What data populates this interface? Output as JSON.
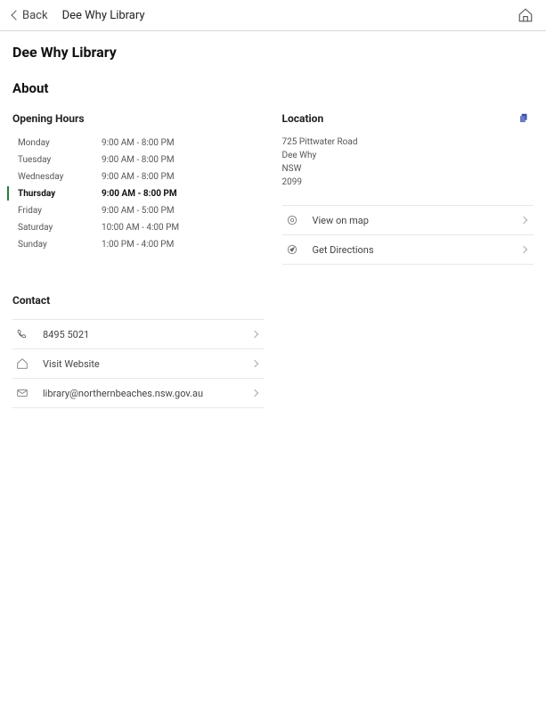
{
  "header": {
    "back_label": "Back",
    "title": "Dee Why Library"
  },
  "page_title": "Dee Why Library",
  "about_label": "About",
  "hours": {
    "heading": "Opening Hours",
    "days": [
      {
        "label": "Monday",
        "time": "9:00 AM - 8:00 PM",
        "current": false
      },
      {
        "label": "Tuesday",
        "time": "9:00 AM - 8:00 PM",
        "current": false
      },
      {
        "label": "Wednesday",
        "time": "9:00 AM - 8:00 PM",
        "current": false
      },
      {
        "label": "Thursday",
        "time": "9:00 AM - 8:00 PM",
        "current": true
      },
      {
        "label": "Friday",
        "time": "9:00 AM - 5:00 PM",
        "current": false
      },
      {
        "label": "Saturday",
        "time": "10:00 AM - 4:00 PM",
        "current": false
      },
      {
        "label": "Sunday",
        "time": "1:00 PM - 4:00 PM",
        "current": false
      }
    ]
  },
  "location": {
    "heading": "Location",
    "address": {
      "line1": "725 Pittwater Road",
      "line2": "Dee Why",
      "line3": "NSW",
      "line4": "2099"
    },
    "actions": {
      "view_map": "View on map",
      "directions": "Get Directions"
    }
  },
  "contact": {
    "heading": "Contact",
    "phone": "8495 5021",
    "website": "Visit Website",
    "email": "library@northernbeaches.nsw.gov.au"
  }
}
